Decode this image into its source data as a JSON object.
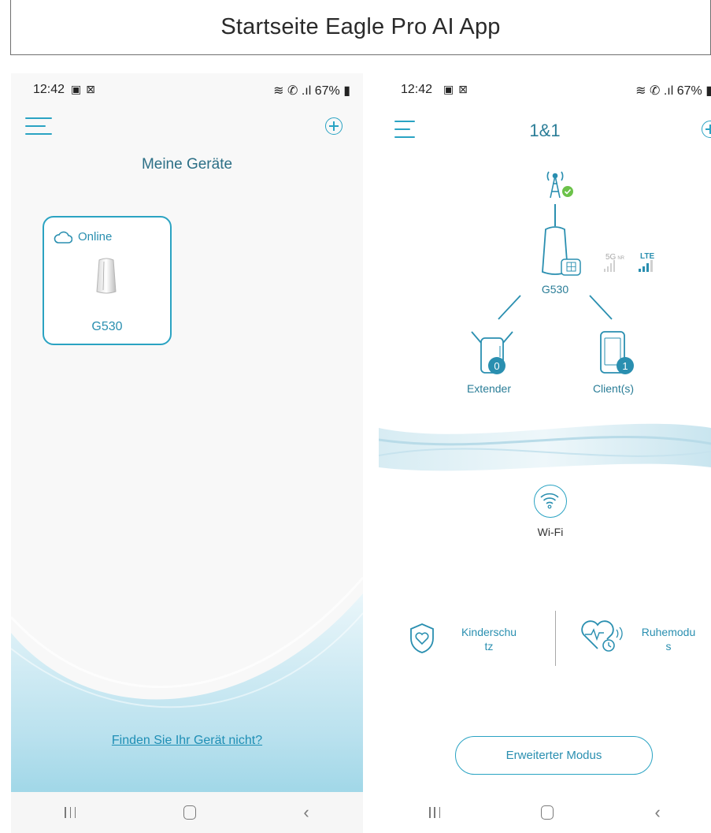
{
  "banner": {
    "title": "Startseite Eagle Pro AI App"
  },
  "left_screen": {
    "status": {
      "time": "12:42",
      "notifications": "▣ ⊠",
      "right": "≋ ✆ .ıl 67% ▮"
    },
    "heading": "Meine Geräte",
    "device_card": {
      "status": "Online",
      "name": "G530"
    },
    "find_link": "Finden Sie Ihr Gerät nicht?"
  },
  "right_screen": {
    "status": {
      "time": "12:42",
      "notifications": "▣ ⊠",
      "right": "≋ ✆ .ıl 67% ▮"
    },
    "title": "1&1",
    "router": {
      "name": "G530",
      "signal_5g": "5G",
      "signal_5g_suffix": "NR",
      "signal_lte": "LTE"
    },
    "extender": {
      "label": "Extender",
      "count": "0"
    },
    "clients": {
      "label": "Client(s)",
      "count": "1"
    },
    "wifi_label": "Wi-Fi",
    "features": [
      {
        "label_line1": "Kinderschu",
        "label_line2": "tz"
      },
      {
        "label_line1": "Ruhemodu",
        "label_line2": "s"
      }
    ],
    "advanced_button": "Erweiterter Modus"
  },
  "colors": {
    "accent": "#2aa3c3",
    "accent_dark": "#2a8fb0",
    "wave_light": "#cfe9f2",
    "status_ok": "#6cc24a"
  },
  "icons": [
    "menu-icon",
    "add-icon",
    "cloud-icon",
    "router-icon",
    "cell-tower-icon",
    "check-icon",
    "sim-card-icon",
    "extender-icon",
    "phone-icon",
    "wifi-icon",
    "shield-heart-icon",
    "heart-pulse-clock-icon",
    "recents-icon",
    "home-icon",
    "back-icon"
  ]
}
